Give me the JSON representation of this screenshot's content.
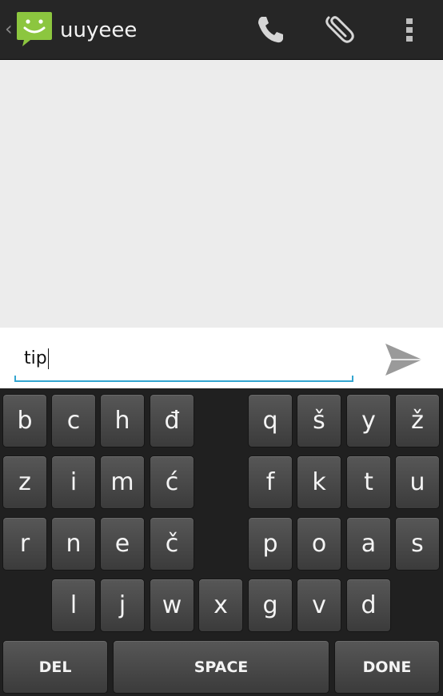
{
  "actionbar": {
    "title": "uuyeee",
    "back_glyph": "‹",
    "icons": {
      "app": "messaging-smiley-icon",
      "call": "phone-icon",
      "attach": "paperclip-icon",
      "more": "overflow-menu-icon"
    },
    "accent": "#8cc63f"
  },
  "compose": {
    "text": "tip",
    "underline_color": "#33a5d0",
    "send_icon": "send-icon"
  },
  "keyboard": {
    "rows": [
      [
        "b",
        "c",
        "h",
        "đ",
        "q",
        "š",
        "y",
        "ž"
      ],
      [
        "z",
        "i",
        "m",
        "ć",
        "f",
        "k",
        "t",
        "u"
      ],
      [
        "r",
        "n",
        "e",
        "č",
        "p",
        "o",
        "a",
        "s"
      ],
      [
        "l",
        "j",
        "w",
        "x",
        "g",
        "v",
        "d"
      ]
    ],
    "del_label": "DEL",
    "space_label": "SPACE",
    "done_label": "DONE"
  }
}
